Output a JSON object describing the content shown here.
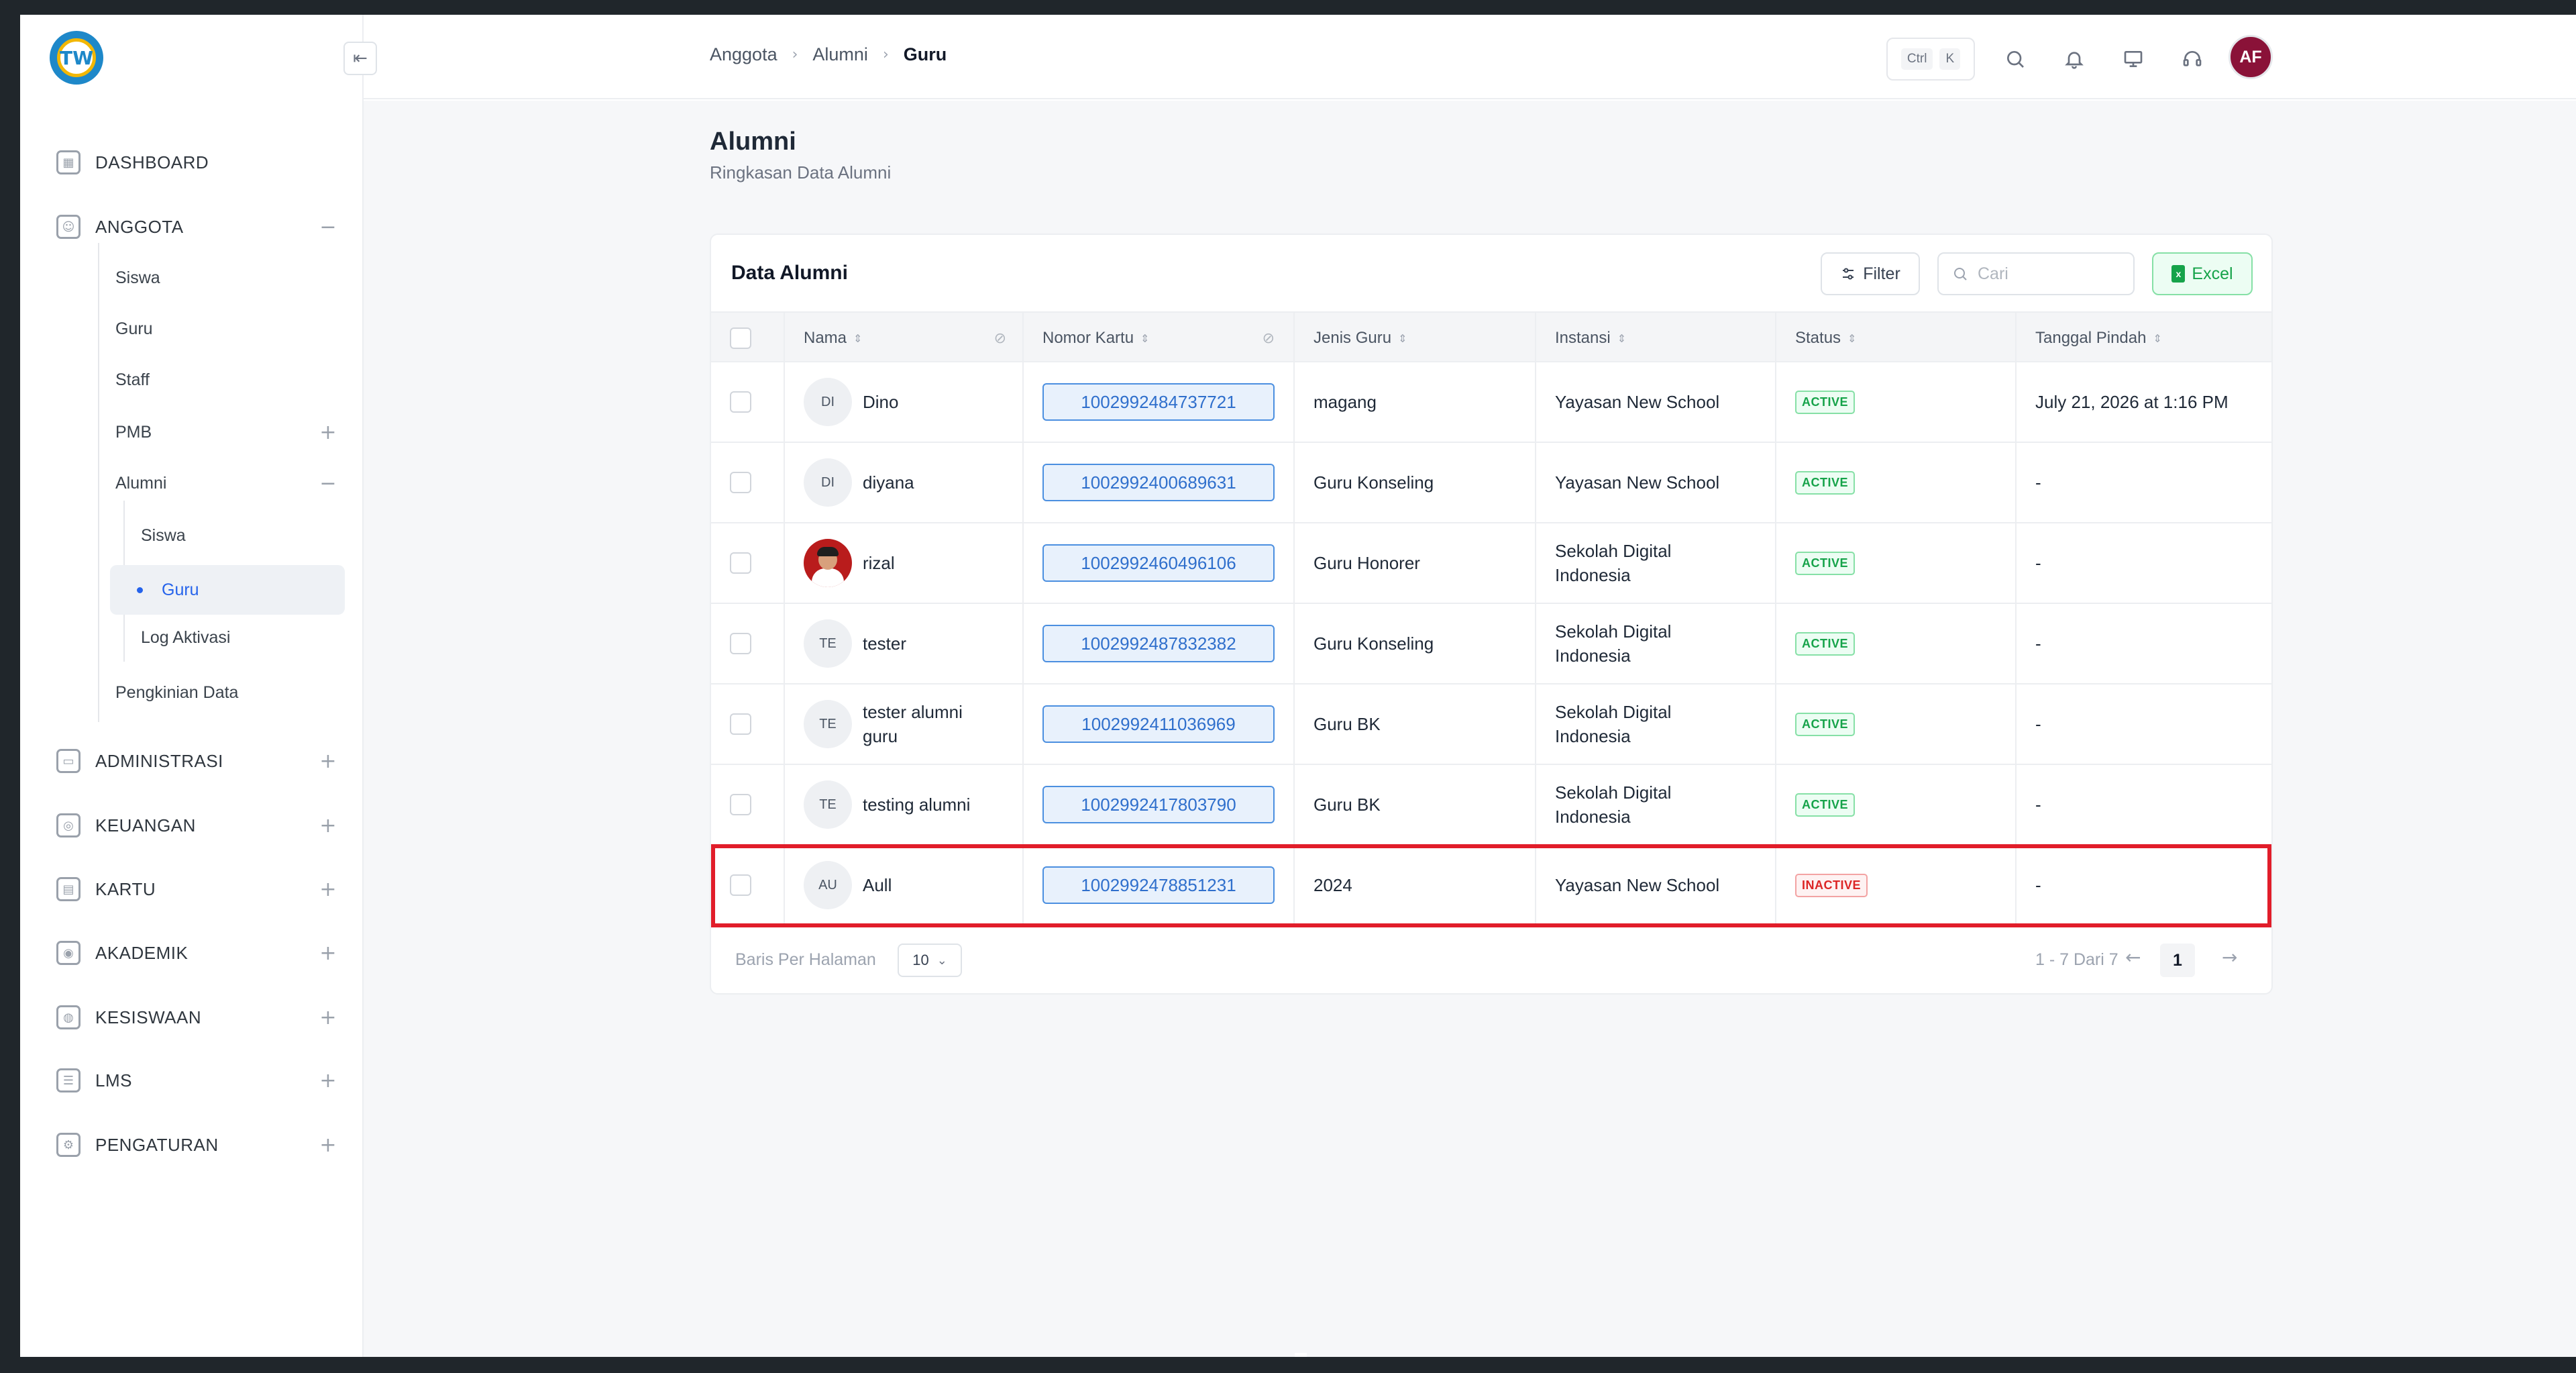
{
  "app": {
    "logo_text": "TW",
    "collapse_icon": "sidebar-collapse-icon"
  },
  "sidebar": {
    "top_items": [
      {
        "label": "DASHBOARD",
        "icon": "grid-icon",
        "toggle": ""
      },
      {
        "label": "ANGGOTA",
        "icon": "users-icon",
        "toggle": "−"
      },
      {
        "label": "ADMINISTRASI",
        "icon": "folder-icon",
        "toggle": "+"
      },
      {
        "label": "KEUANGAN",
        "icon": "money-icon",
        "toggle": "+"
      },
      {
        "label": "KARTU",
        "icon": "card-icon",
        "toggle": "+"
      },
      {
        "label": "AKADEMIK",
        "icon": "academic-icon",
        "toggle": "+"
      },
      {
        "label": "KESISWAAN",
        "icon": "student-icon",
        "toggle": "+"
      },
      {
        "label": "LMS",
        "icon": "lms-icon",
        "toggle": "+"
      },
      {
        "label": "PENGATURAN",
        "icon": "gear-icon",
        "toggle": "+"
      }
    ],
    "anggota_items": [
      {
        "label": "Siswa",
        "toggle": ""
      },
      {
        "label": "Guru",
        "toggle": ""
      },
      {
        "label": "Staff",
        "toggle": ""
      },
      {
        "label": "PMB",
        "toggle": "+"
      },
      {
        "label": "Alumni",
        "toggle": "−"
      },
      {
        "label": "Pengkinian Data",
        "toggle": ""
      }
    ],
    "alumni_items": [
      {
        "label": "Siswa"
      },
      {
        "label": "Guru"
      },
      {
        "label": "Log Aktivasi"
      }
    ]
  },
  "header": {
    "breadcrumb": [
      "Anggota",
      "Alumni",
      "Guru"
    ],
    "shortcut": [
      "Ctrl",
      "K"
    ],
    "avatar_initials": "AF"
  },
  "page": {
    "title": "Alumni",
    "subtitle": "Ringkasan Data Alumni"
  },
  "card": {
    "title": "Data Alumni",
    "filter_label": "Filter",
    "search_placeholder": "Cari",
    "excel_label": "Excel"
  },
  "table": {
    "columns": [
      "Nama",
      "Nomor Kartu",
      "Jenis Guru",
      "Instansi",
      "Status",
      "Tanggal Pindah"
    ],
    "rows": [
      {
        "initials": "DI",
        "photo": false,
        "name": "Dino",
        "card": "1002992484737721",
        "jenis": "magang",
        "instansi": "Yayasan New School",
        "status": "ACTIVE",
        "tanggal": "July 21, 2026 at 1:16 PM"
      },
      {
        "initials": "DI",
        "photo": false,
        "name": "diyana",
        "card": "1002992400689631",
        "jenis": "Guru Konseling",
        "instansi": "Yayasan New School",
        "status": "ACTIVE",
        "tanggal": "-"
      },
      {
        "initials": "",
        "photo": true,
        "name": "rizal",
        "card": "1002992460496106",
        "jenis": "Guru Honorer",
        "instansi": "Sekolah Digital Indonesia",
        "status": "ACTIVE",
        "tanggal": "-"
      },
      {
        "initials": "TE",
        "photo": false,
        "name": "tester",
        "card": "1002992487832382",
        "jenis": "Guru Konseling",
        "instansi": "Sekolah Digital Indonesia",
        "status": "ACTIVE",
        "tanggal": "-"
      },
      {
        "initials": "TE",
        "photo": false,
        "name": "tester alumni guru",
        "card": "1002992411036969",
        "jenis": "Guru BK",
        "instansi": "Sekolah Digital Indonesia",
        "status": "ACTIVE",
        "tanggal": "-"
      },
      {
        "initials": "TE",
        "photo": false,
        "name": "testing alumni",
        "card": "1002992417803790",
        "jenis": "Guru BK",
        "instansi": "Sekolah Digital Indonesia",
        "status": "ACTIVE",
        "tanggal": "-"
      },
      {
        "initials": "AU",
        "photo": false,
        "name": "Aull",
        "card": "1002992478851231",
        "jenis": "2024",
        "instansi": "Yayasan New School",
        "status": "INACTIVE",
        "tanggal": "-"
      }
    ]
  },
  "footer": {
    "rows_per_page_label": "Baris Per Halaman",
    "rows_per_page_value": "10",
    "page_info": "1 - 7 Dari 7",
    "current_page": "1"
  }
}
